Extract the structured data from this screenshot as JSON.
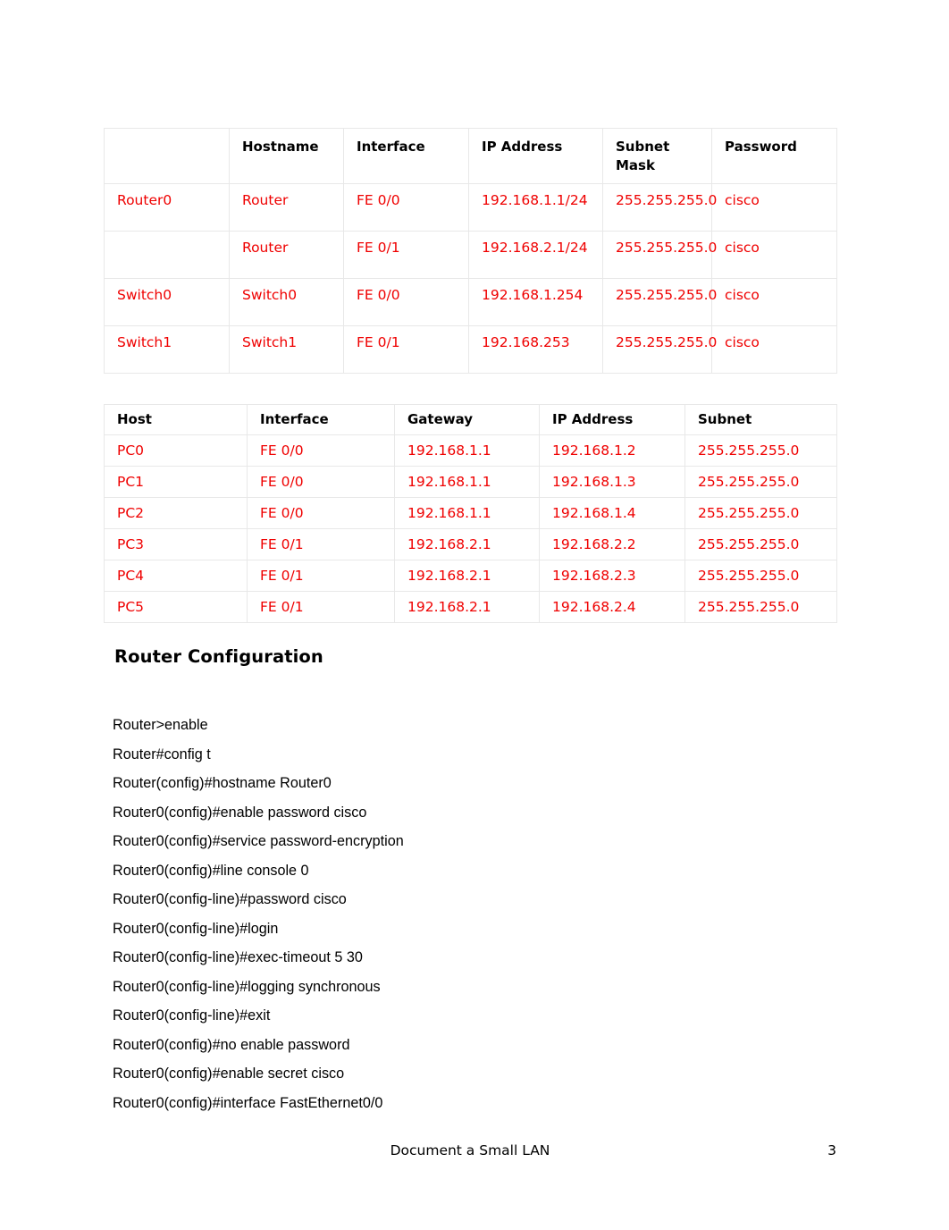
{
  "document": {
    "footer_title": "Document a Small LAN",
    "page_number": "3",
    "accent_red": "#ef0000",
    "border_color": "#e8e8e8"
  },
  "device_table": {
    "name": "device-configuration-table",
    "headers": [
      "",
      "Hostname",
      "Interface",
      "IP Address",
      "Subnet Mask",
      "Password"
    ],
    "rows": [
      {
        "device": "Router0",
        "hostname": "Router",
        "interface": "FE 0/0",
        "ip_address": "192.168.1.1/24",
        "subnet_mask": "255.255.255.0",
        "password": "cisco"
      },
      {
        "device": "",
        "hostname": "Router",
        "interface": "FE 0/1",
        "ip_address": "192.168.2.1/24",
        "subnet_mask": "255.255.255.0",
        "password": "cisco"
      },
      {
        "device": "Switch0",
        "hostname": "Switch0",
        "interface": "FE 0/0",
        "ip_address": "192.168.1.254",
        "subnet_mask": "255.255.255.0",
        "password": "cisco"
      },
      {
        "device": "Switch1",
        "hostname": "Switch1",
        "interface": "FE 0/1",
        "ip_address": "192.168.253",
        "subnet_mask": "255.255.255.0",
        "password": "cisco"
      }
    ]
  },
  "host_table": {
    "name": "host-addressing-table",
    "headers": [
      "Host",
      "Interface",
      "Gateway",
      "IP Address",
      "Subnet"
    ],
    "rows": [
      {
        "host": "PC0",
        "interface": "FE 0/0",
        "gateway": "192.168.1.1",
        "ip_address": "192.168.1.2",
        "subnet": "255.255.255.0"
      },
      {
        "host": "PC1",
        "interface": "FE 0/0",
        "gateway": "192.168.1.1",
        "ip_address": "192.168.1.3",
        "subnet": "255.255.255.0"
      },
      {
        "host": "PC2",
        "interface": "FE 0/0",
        "gateway": "192.168.1.1",
        "ip_address": "192.168.1.4",
        "subnet": "255.255.255.0"
      },
      {
        "host": "PC3",
        "interface": "FE 0/1",
        "gateway": "192.168.2.1",
        "ip_address": "192.168.2.2",
        "subnet": "255.255.255.0"
      },
      {
        "host": "PC4",
        "interface": "FE 0/1",
        "gateway": "192.168.2.1",
        "ip_address": "192.168.2.3",
        "subnet": "255.255.255.0"
      },
      {
        "host": "PC5",
        "interface": "FE 0/1",
        "gateway": "192.168.2.1",
        "ip_address": "192.168.2.4",
        "subnet": "255.255.255.0"
      }
    ]
  },
  "router_configuration": {
    "heading": "Router Configuration",
    "lines": [
      "Router>enable",
      "Router#config t",
      "Router(config)#hostname Router0",
      "Router0(config)#enable password cisco",
      "Router0(config)#service password-encryption",
      "Router0(config)#line console 0",
      "Router0(config-line)#password cisco",
      "Router0(config-line)#login",
      "Router0(config-line)#exec-timeout 5 30",
      "Router0(config-line)#logging synchronous",
      "Router0(config-line)#exit",
      "Router0(config)#no enable password",
      "Router0(config)#enable secret cisco",
      "Router0(config)#interface FastEthernet0/0"
    ]
  }
}
